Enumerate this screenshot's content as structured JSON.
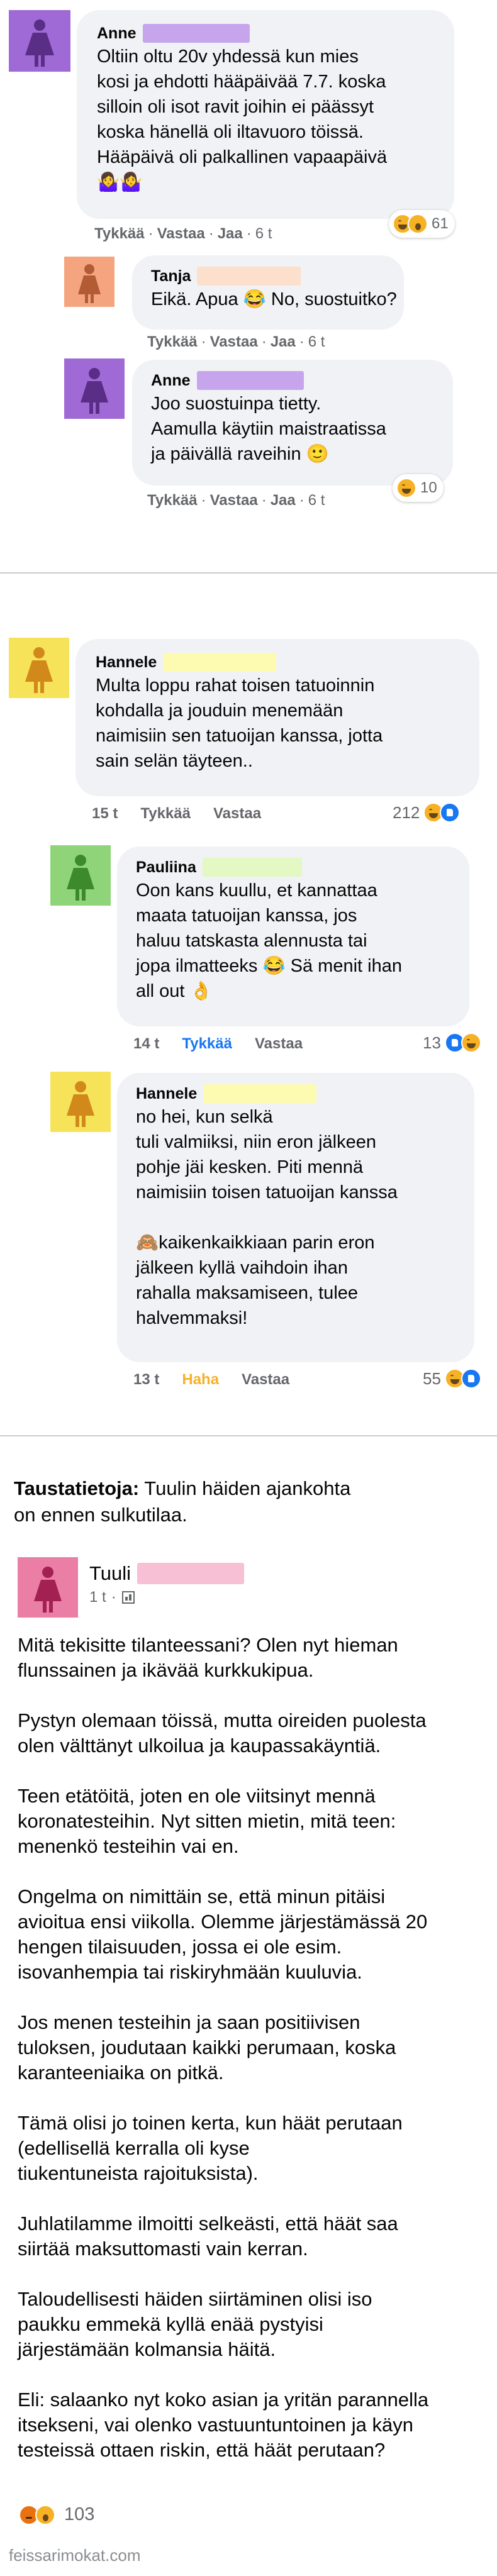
{
  "colors": {
    "anne_avatar": "#a06ad6",
    "anne_redact": "#c7a5ec",
    "tanja_avatar": "#f4a57f",
    "tanja_redact": "#fde0cc",
    "hannele_avatar": "#f7e35a",
    "hannele_redact": "#fdfbb2",
    "pauliina_avatar": "#8fd478",
    "pauliina_redact": "#e3f8c3",
    "tuuli_avatar": "#ea7ea5",
    "tuuli_redact": "#f7c0d4"
  },
  "thread1": {
    "c1": {
      "name": "Anne",
      "lines": [
        "Oltiin oltu 20v yhdessä kun mies",
        "kosi ja ehdotti hääpäivää 7.7. koska",
        "silloin oli isot ravit joihin ei päässyt",
        "koska hänellä oli iltavuoro töissä.",
        "Hääpäivä oli palkallinen vapaapäivä",
        "🤷‍♀️🤷‍♀️"
      ],
      "meta": {
        "like": "Tykkää",
        "reply": "Vastaa",
        "share": "Jaa",
        "time": "6 t"
      },
      "reaction_count": "61"
    },
    "c2": {
      "name": "Tanja",
      "lines": [
        "Eikä. Apua 😂 No, suostuitko?"
      ],
      "meta": {
        "like": "Tykkää",
        "reply": "Vastaa",
        "share": "Jaa",
        "time": "6 t"
      }
    },
    "c3": {
      "name": "Anne",
      "lines": [
        "Joo suostuinpa tietty.",
        "Aamulla käytiin maistraatissa",
        "ja päivällä raveihin 🙂"
      ],
      "meta": {
        "like": "Tykkää",
        "reply": "Vastaa",
        "share": "Jaa",
        "time": "6 t"
      },
      "reaction_count": "10"
    }
  },
  "thread2": {
    "c1": {
      "name": "Hannele",
      "lines": [
        "Multa loppu rahat toisen tatuoinnin",
        "kohdalla ja jouduin menemään",
        "naimisiin sen tatuoijan kanssa, jotta",
        "sain selän täyteen.."
      ],
      "meta": {
        "time": "15 t",
        "like": "Tykkää",
        "reply": "Vastaa"
      },
      "reaction_count": "212"
    },
    "c2": {
      "name": "Pauliina",
      "lines": [
        "Oon kans kuullu, et kannattaa",
        "maata tatuoijan kanssa, jos",
        "haluu tatskasta alennusta tai",
        "jopa ilmatteeks 😂 Sä menit ihan",
        "all out 👌"
      ],
      "meta": {
        "time": "14 t",
        "like": "Tykkää",
        "reply": "Vastaa"
      },
      "reaction_count": "13"
    },
    "c3": {
      "name": "Hannele",
      "lines": [
        "no hei, kun selkä",
        "tuli valmiiksi, niin eron jälkeen",
        "pohje jäi kesken. Piti mennä",
        "naimisiin toisen tatuoijan kanssa",
        "",
        "🙈kaikenkaikkiaan parin eron",
        "jälkeen kyllä vaihdoin ihan",
        "rahalla maksamiseen, tulee",
        "halvemmaksi!"
      ],
      "meta": {
        "time": "13 t",
        "like": "Haha",
        "reply": "Vastaa"
      },
      "reaction_count": "55"
    }
  },
  "post": {
    "background_label": "Taustatietoja:",
    "background_text_1": " Tuulin häiden ajankohta",
    "background_text_2": "on ennen sulkutilaa.",
    "author": "Tuuli",
    "time": "1 t",
    "dot": "·",
    "paragraphs": [
      [
        "Mitä tekisitte tilanteessani? Olen nyt hieman",
        "flunssainen ja ikävää kurkkukipua."
      ],
      [
        "Pystyn olemaan töissä, mutta oireiden puolesta",
        "olen välttänyt ulkoilua ja kaupassakäyntiä."
      ],
      [
        "Teen etätöitä, joten en ole viitsinyt mennä",
        "koronatesteihin. Nyt sitten mietin, mitä teen:",
        "menenkö testeihin vai en."
      ],
      [
        "Ongelma on nimittäin se, että minun pitäisi",
        "avioitua ensi viikolla. Olemme järjestämässä 20",
        "hengen tilaisuuden, jossa ei ole esim.",
        "isovanhempia tai riskiryhmään kuuluvia."
      ],
      [
        "Jos menen testeihin ja saan positiivisen",
        "tuloksen, joudutaan kaikki perumaan, koska",
        "karanteeniaika on pitkä."
      ],
      [
        "Tämä olisi jo toinen kerta, kun häät perutaan",
        "(edellisellä kerralla oli kyse",
        "tiukentuneista rajoituksista)."
      ],
      [
        "Juhlatilamme ilmoitti selkeästi, että häät saa",
        "siirtää maksuttomasti vain kerran."
      ],
      [
        "Taloudellisesti häiden siirtäminen olisi iso",
        "paukku emmekä kyllä enää pystyisi",
        "järjestämään kolmansia häitä."
      ],
      [
        "Eli: salaanko nyt koko asian ja yritän parannella",
        "itsekseni, vai olenko vastuuntuntoinen ja käyn",
        "testeissä ottaen riskin, että häät perutaan?"
      ]
    ],
    "reaction_count": "103"
  },
  "watermark": "feissarimokat.com"
}
